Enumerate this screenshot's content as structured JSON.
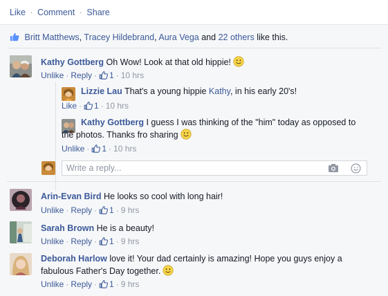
{
  "actions": {
    "like": "Like",
    "comment": "Comment",
    "share": "Share",
    "separator": "·"
  },
  "likes": {
    "names": [
      "Britt Matthews",
      "Tracey Hildebrand",
      "Aura Vega"
    ],
    "comma": ",",
    "and": "and",
    "others": "22 others",
    "suffix": "like this."
  },
  "colors": {
    "link": "#3b5998",
    "meta": "#9197a3",
    "ufi_bg": "#f6f7f9"
  },
  "comments": [
    {
      "name": "Kathy Gottberg",
      "text": "Oh Wow! Look at that old hippie!",
      "emoji": "smiley-icon",
      "action": "Unlike",
      "reply": "Reply",
      "likes": "1",
      "time": "10 hrs",
      "replies": [
        {
          "name": "Lizzie Lau",
          "text_before": "That's a young hippie",
          "mention": "Kathy",
          "text_after": ", in his early 20's!",
          "action": "Like",
          "likes": "1",
          "time": "10 hrs"
        },
        {
          "name": "Kathy Gottberg",
          "text_line1": "I guess I was thinking of the \"him\" today as opposed to",
          "text_line2": "the photos. Thanks fro sharing",
          "emoji": "smiley-icon",
          "action": "Unlike",
          "likes": "1",
          "time": "10 hrs"
        }
      ],
      "reply_placeholder": "Write a reply..."
    },
    {
      "name": "Arin-Evan Bird",
      "text": "He looks so cool with long hair!",
      "action": "Unlike",
      "reply": "Reply",
      "likes": "1",
      "time": "9 hrs"
    },
    {
      "name": "Sarah Brown",
      "text": "He is a beauty!",
      "action": "Unlike",
      "reply": "Reply",
      "likes": "1",
      "time": "9 hrs"
    },
    {
      "name": "Deborah Harlow",
      "text_line1": "love it! Your dad certainly is amazing! Hope you guys enjoy a",
      "text_line2": "fabulous Father's Day together.",
      "emoji": "smiley-icon",
      "action": "Unlike",
      "reply": "Reply",
      "likes": "1",
      "time": "9 hrs"
    }
  ]
}
